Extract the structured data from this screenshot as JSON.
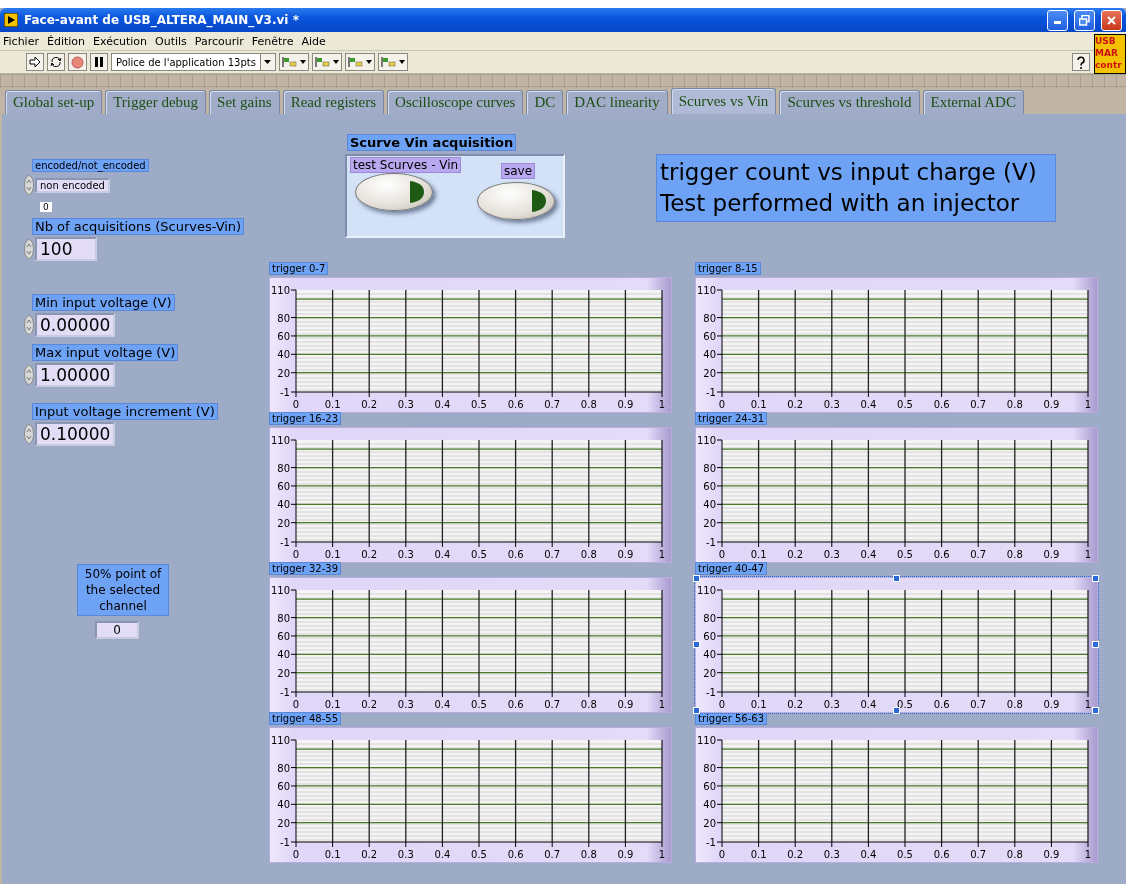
{
  "window": {
    "title": "Face-avant de USB_ALTERA_MAIN_V3.vi *"
  },
  "menu": [
    "Fichier",
    "Édition",
    "Exécution",
    "Outils",
    "Parcourir",
    "Fenêtre",
    "Aide"
  ],
  "toolbar": {
    "font_selector": "Police de l'application 13pts"
  },
  "corner_badge": {
    "lines": [
      "USB",
      "MAR",
      "contr"
    ]
  },
  "tabs": [
    {
      "label": "Global set-up",
      "selected": false
    },
    {
      "label": "Trigger debug",
      "selected": false
    },
    {
      "label": "Set gains",
      "selected": false
    },
    {
      "label": "Read registers",
      "selected": false
    },
    {
      "label": "Oscilloscope curves",
      "selected": false
    },
    {
      "label": "DC",
      "selected": false
    },
    {
      "label": "DAC linearity",
      "selected": false
    },
    {
      "label": "Scurves vs Vin",
      "selected": true
    },
    {
      "label": "Scurves vs threshold",
      "selected": false
    },
    {
      "label": "External ADC",
      "selected": false
    }
  ],
  "encoding": {
    "label": "encoded/not_encoded",
    "value": "non encoded",
    "index": "0"
  },
  "numerics": [
    {
      "label": "Nb of acquisitions (Scurves-Vin)",
      "value": "100"
    },
    {
      "label": "Min input voltage (V)",
      "value": "0.00000"
    },
    {
      "label": "Max input voltage (V)",
      "value": "1.00000"
    },
    {
      "label": "Input voltage increment (V)",
      "value": "0.10000"
    }
  ],
  "acquisition": {
    "title": "Scurve Vin acquisition",
    "buttons": [
      {
        "label": "test Scurves - Vin"
      },
      {
        "label": "save"
      }
    ]
  },
  "description": [
    "trigger count vs input charge (V)",
    "Test performed with an injector"
  ],
  "midpoint": {
    "label": "50% point of the selected channel",
    "value": "0"
  },
  "graphs": [
    {
      "selected": false,
      "chart_data": {
        "type": "line",
        "title": "trigger 0-7",
        "grid": true,
        "xlim": [
          0,
          1
        ],
        "ylim": [
          -1,
          110
        ],
        "xticks": [
          0,
          0.1,
          0.2,
          0.3,
          0.4,
          0.5,
          0.6,
          0.7,
          0.8,
          0.9,
          1
        ],
        "yticks": [
          -1,
          20,
          40,
          60,
          80,
          110
        ]
      }
    },
    {
      "selected": false,
      "chart_data": {
        "type": "line",
        "title": "trigger 8-15",
        "grid": true,
        "xlim": [
          0,
          1
        ],
        "ylim": [
          -1,
          110
        ],
        "xticks": [
          0,
          0.1,
          0.2,
          0.3,
          0.4,
          0.5,
          0.6,
          0.7,
          0.8,
          0.9,
          1
        ],
        "yticks": [
          -1,
          20,
          40,
          60,
          80,
          110
        ]
      }
    },
    {
      "selected": false,
      "chart_data": {
        "type": "line",
        "title": "trigger 16-23",
        "grid": true,
        "xlim": [
          0,
          1
        ],
        "ylim": [
          -1,
          110
        ],
        "xticks": [
          0,
          0.1,
          0.2,
          0.3,
          0.4,
          0.5,
          0.6,
          0.7,
          0.8,
          0.9,
          1
        ],
        "yticks": [
          -1,
          20,
          40,
          60,
          80,
          110
        ]
      }
    },
    {
      "selected": false,
      "chart_data": {
        "type": "line",
        "title": "trigger 24-31",
        "grid": true,
        "xlim": [
          0,
          1
        ],
        "ylim": [
          -1,
          110
        ],
        "xticks": [
          0,
          0.1,
          0.2,
          0.3,
          0.4,
          0.5,
          0.6,
          0.7,
          0.8,
          0.9,
          1
        ],
        "yticks": [
          -1,
          20,
          40,
          60,
          80,
          110
        ]
      }
    },
    {
      "selected": false,
      "chart_data": {
        "type": "line",
        "title": "trigger 32-39",
        "grid": true,
        "xlim": [
          0,
          1
        ],
        "ylim": [
          -1,
          110
        ],
        "xticks": [
          0,
          0.1,
          0.2,
          0.3,
          0.4,
          0.5,
          0.6,
          0.7,
          0.8,
          0.9,
          1
        ],
        "yticks": [
          -1,
          20,
          40,
          60,
          80,
          110
        ]
      }
    },
    {
      "selected": true,
      "chart_data": {
        "type": "line",
        "title": "trigger 40-47",
        "grid": true,
        "xlim": [
          0,
          1
        ],
        "ylim": [
          -1,
          110
        ],
        "xticks": [
          0,
          0.1,
          0.2,
          0.3,
          0.4,
          0.5,
          0.6,
          0.7,
          0.8,
          0.9,
          1
        ],
        "yticks": [
          -1,
          20,
          40,
          60,
          80,
          110
        ]
      }
    },
    {
      "selected": false,
      "chart_data": {
        "type": "line",
        "title": "trigger 48-55",
        "grid": true,
        "xlim": [
          0,
          1
        ],
        "ylim": [
          -1,
          110
        ],
        "xticks": [
          0,
          0.1,
          0.2,
          0.3,
          0.4,
          0.5,
          0.6,
          0.7,
          0.8,
          0.9,
          1
        ],
        "yticks": [
          -1,
          20,
          40,
          60,
          80,
          110
        ]
      }
    },
    {
      "selected": false,
      "chart_data": {
        "type": "line",
        "title": "trigger 56-63",
        "grid": true,
        "xlim": [
          0,
          1
        ],
        "ylim": [
          -1,
          110
        ],
        "xticks": [
          0,
          0.1,
          0.2,
          0.3,
          0.4,
          0.5,
          0.6,
          0.7,
          0.8,
          0.9,
          1
        ],
        "yticks": [
          -1,
          20,
          40,
          60,
          80,
          110
        ]
      }
    }
  ]
}
